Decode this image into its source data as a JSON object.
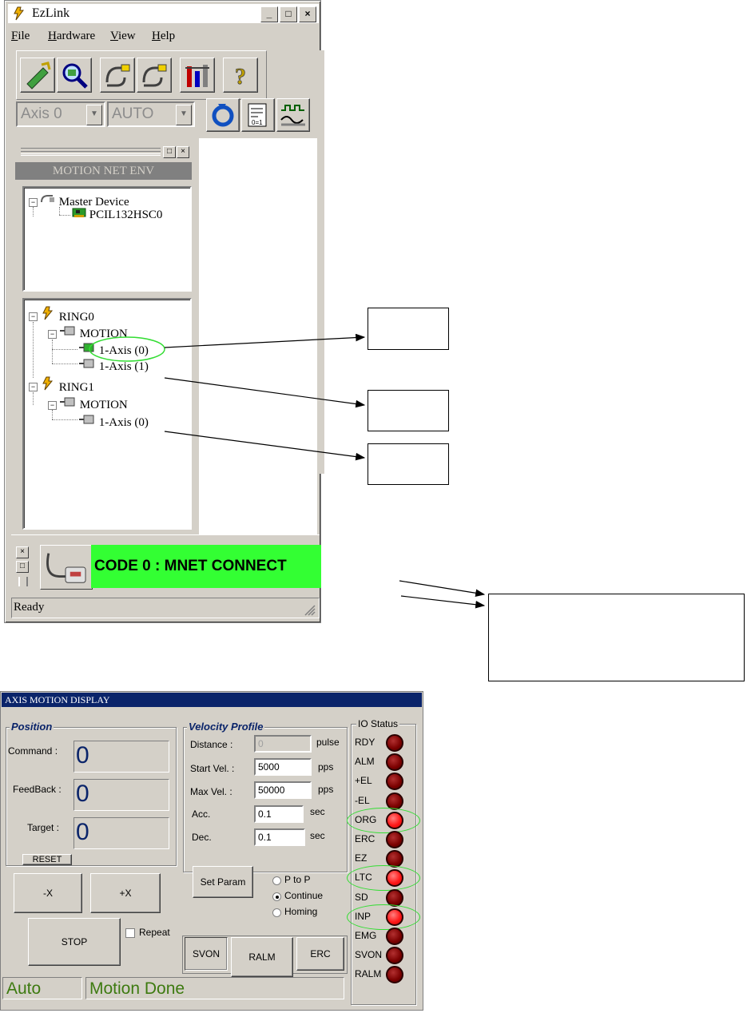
{
  "ezlink": {
    "title": "EzLink",
    "title_buttons": {
      "minimize": "_",
      "maximize": "□",
      "close": "×"
    },
    "menu": [
      "File",
      "Hardware",
      "View",
      "Help"
    ],
    "menu_underline": [
      "F",
      "H",
      "V",
      "H"
    ],
    "menu_rest": [
      "ile",
      "ardware",
      "iew",
      "elp"
    ],
    "toolbar_icons": [
      "connect-icon",
      "search-device-icon",
      "ring-icon",
      "ring-off-icon",
      "tools-icon",
      "help-icon"
    ],
    "axis_select": "Axis 0",
    "mode_select": "AUTO",
    "toolbar2_icons": [
      "reset-icon",
      "io-config-icon",
      "motion-chart-icon"
    ],
    "pane": {
      "header": "MOTION NET ENV",
      "device_tree": {
        "root": "Master Device",
        "child": "PCIL132HSC0"
      },
      "ring_tree": [
        {
          "label": "RING0",
          "children": [
            {
              "label": "MOTION",
              "axes": [
                "1-Axis (0)",
                "1-Axis (1)"
              ]
            }
          ]
        },
        {
          "label": "RING1",
          "children": [
            {
              "label": "MOTION",
              "axes": [
                "1-Axis (0)"
              ]
            }
          ]
        }
      ]
    },
    "connection_status": "CODE 0 : MNET CONNECT",
    "status_bar": "Ready"
  },
  "axis_motion_display": {
    "title": "AXIS MOTION DISPLAY",
    "position": {
      "title": "Position",
      "command_label": "Command :",
      "command_value": "0",
      "feedback_label": "FeedBack :",
      "feedback_value": "0",
      "target_label": "Target :",
      "target_value": "0",
      "reset_label": "RESET"
    },
    "velocity": {
      "title": "Velocity Profile",
      "distance_label": "Distance :",
      "distance_value": "0",
      "distance_unit": "pulse",
      "start_label": "Start Vel. :",
      "start_value": "5000",
      "start_unit": "pps",
      "max_label": "Max Vel. :",
      "max_value": "50000",
      "max_unit": "pps",
      "acc_label": "Acc.",
      "acc_value": "0.1",
      "acc_unit": "sec",
      "dec_label": "Dec.",
      "dec_value": "0.1",
      "dec_unit": "sec",
      "set_param": "Set Param",
      "modes": [
        "P to P",
        "Continue",
        "Homing"
      ],
      "selected_mode": "Continue"
    },
    "buttons": {
      "minus_x": "-X",
      "plus_x": "+X",
      "stop": "STOP",
      "repeat": "Repeat",
      "svon": "SVON",
      "ralm": "RALM",
      "erc": "ERC"
    },
    "io_status": {
      "title": "IO Status",
      "signals": [
        {
          "name": "RDY",
          "on": false
        },
        {
          "name": "ALM",
          "on": false
        },
        {
          "name": "+EL",
          "on": false
        },
        {
          "name": "-EL",
          "on": false
        },
        {
          "name": "ORG",
          "on": true
        },
        {
          "name": "ERC",
          "on": false
        },
        {
          "name": "EZ",
          "on": false
        },
        {
          "name": "LTC",
          "on": true
        },
        {
          "name": "SD",
          "on": false
        },
        {
          "name": "INP",
          "on": true
        },
        {
          "name": "EMG",
          "on": false
        },
        {
          "name": "SVON",
          "on": false
        },
        {
          "name": "RALM",
          "on": false
        }
      ]
    },
    "status": {
      "mode": "Auto",
      "motion": "Motion Done"
    }
  },
  "colors": {
    "connect_green": "#33ff33",
    "led_on": "#ff1a1a",
    "led_off": "#7a0000",
    "highlight_ring": "#33dd33",
    "title_navy": "#0a246a"
  }
}
